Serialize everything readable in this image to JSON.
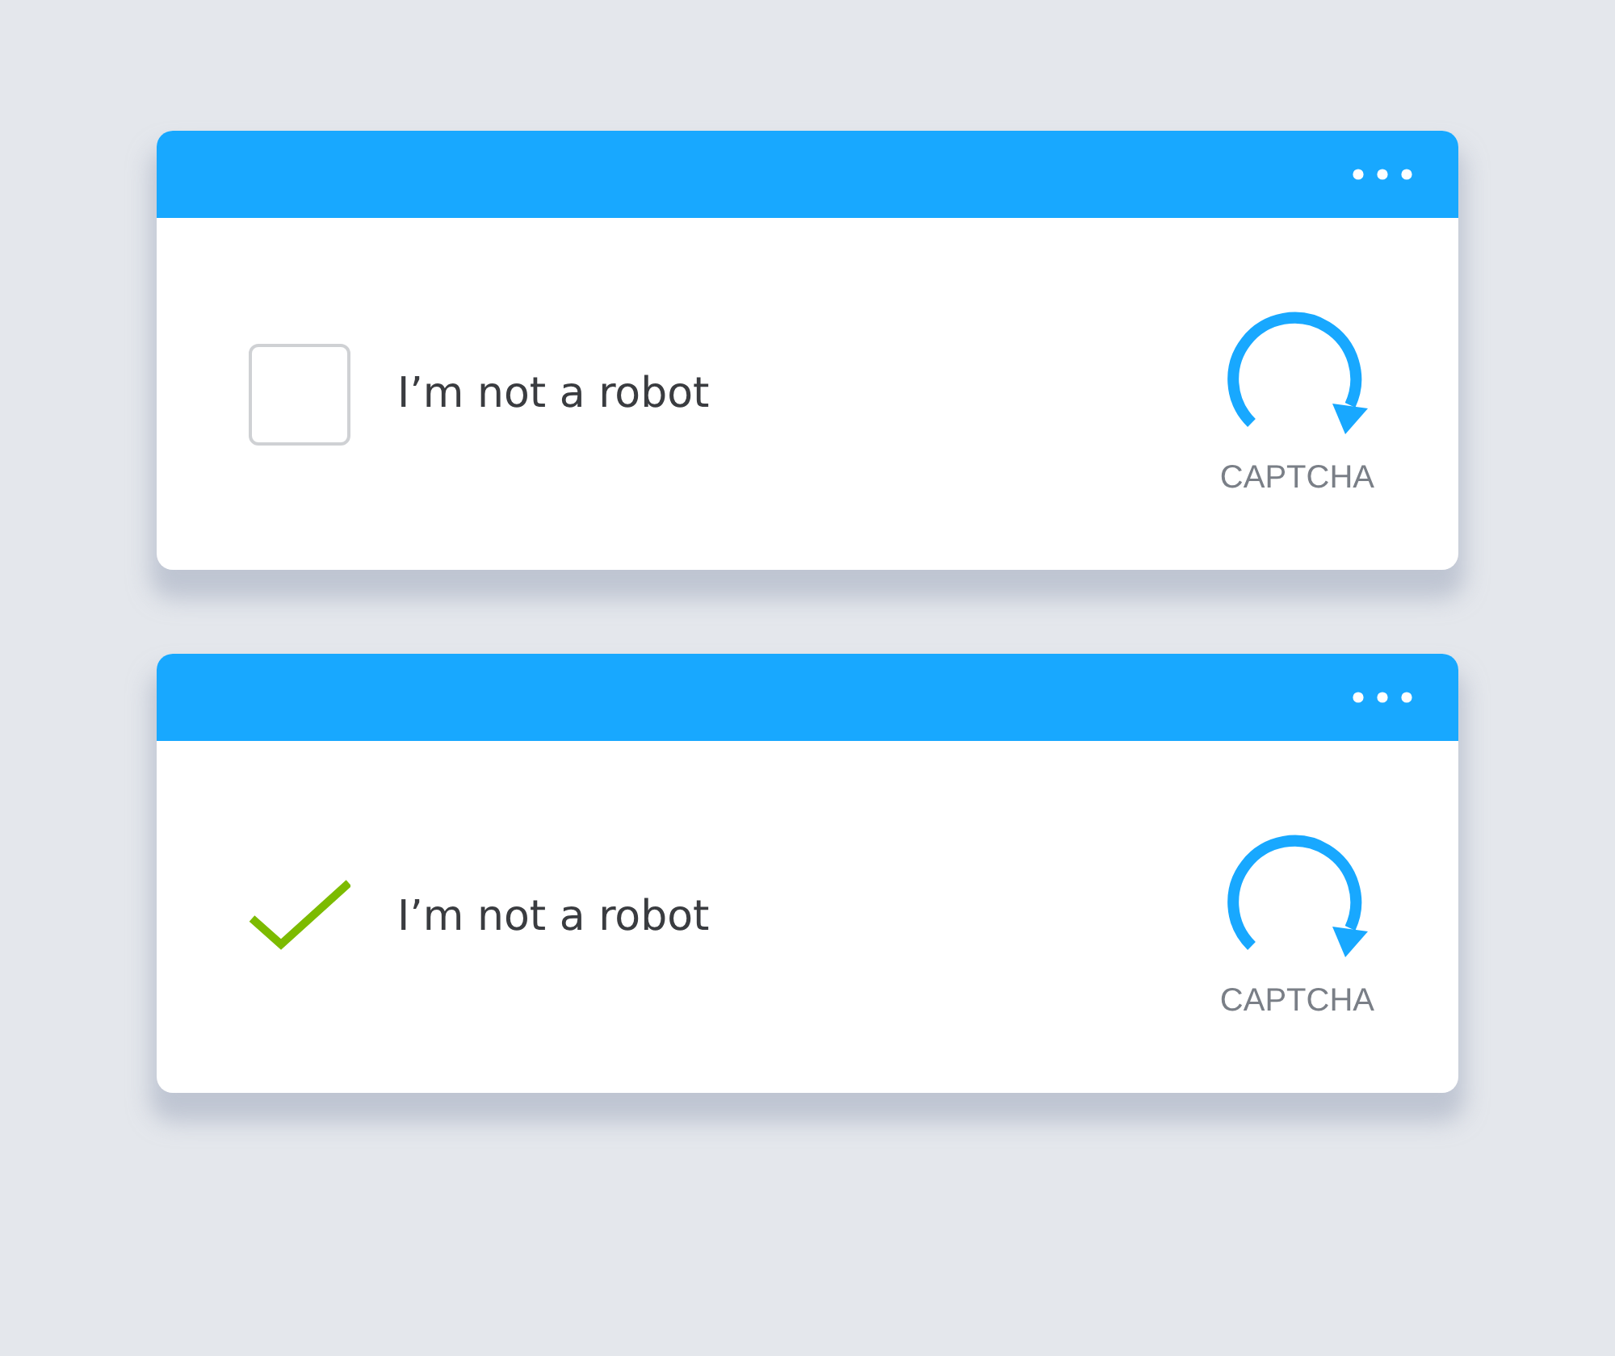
{
  "captchas": [
    {
      "label": "I’m not a robot",
      "checked": false,
      "logo_text": "CAPTCHA"
    },
    {
      "label": "I’m not a robot",
      "checked": true,
      "logo_text": "CAPTCHA"
    }
  ]
}
